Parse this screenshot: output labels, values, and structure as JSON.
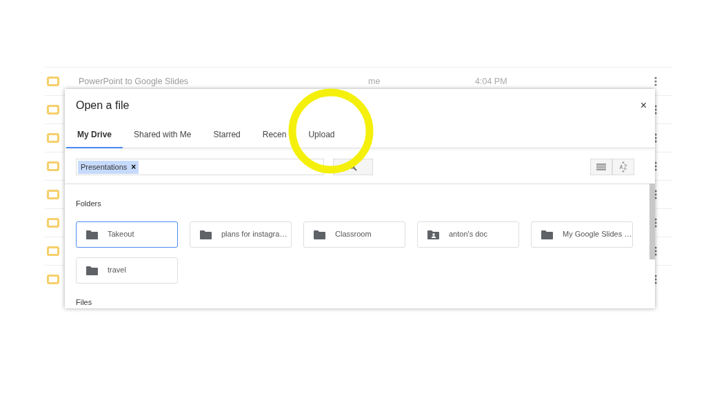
{
  "background_list": {
    "rows": [
      {
        "name": "PowerPoint to Google Slides",
        "owner": "me",
        "modified": "4:04 PM"
      },
      {},
      {},
      {},
      {},
      {},
      {},
      {}
    ]
  },
  "dialog": {
    "title": "Open a file",
    "close": "×",
    "tabs": [
      {
        "label": "My Drive",
        "selected": true
      },
      {
        "label": "Shared with Me",
        "selected": false
      },
      {
        "label": "Starred",
        "selected": false
      },
      {
        "label": "Recen",
        "selected": false
      },
      {
        "label": "Upload",
        "selected": false
      }
    ],
    "search": {
      "chips": [
        {
          "label": "Presentations",
          "remove": "×"
        }
      ]
    },
    "sections": [
      {
        "title": "Folders",
        "folders": [
          {
            "name": "Takeout",
            "kind": "folder",
            "selected": true
          },
          {
            "name": "plans for instagra…",
            "kind": "folder",
            "selected": false
          },
          {
            "name": "Classroom",
            "kind": "folder",
            "selected": false
          },
          {
            "name": "anton's doc",
            "kind": "shared",
            "selected": false
          },
          {
            "name": "My Google Slides …",
            "kind": "folder",
            "selected": false
          },
          {
            "name": "travel",
            "kind": "folder",
            "selected": false
          }
        ]
      },
      {
        "title": "Files"
      }
    ]
  },
  "highlight": {
    "kind": "circle"
  }
}
